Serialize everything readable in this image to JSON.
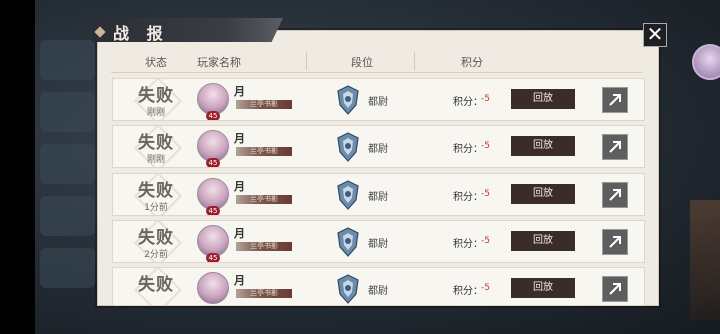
{
  "window": {
    "title": "战 报",
    "close_label": "✕"
  },
  "header": {
    "status": "状态",
    "player": "玩家名称",
    "rank": "段位",
    "score": "积分"
  },
  "rows": [
    {
      "status": "失败",
      "time": "刚刚",
      "name": "月",
      "title": "兰亭书影",
      "level": "45",
      "rank": "都尉",
      "score_label": "积分：",
      "score": "-5",
      "replay": "回放"
    },
    {
      "status": "失败",
      "time": "刚刚",
      "name": "月",
      "title": "兰亭书影",
      "level": "45",
      "rank": "都尉",
      "score_label": "积分：",
      "score": "-5",
      "replay": "回放"
    },
    {
      "status": "失败",
      "time": "1分前",
      "name": "月",
      "title": "兰亭书影",
      "level": "45",
      "rank": "都尉",
      "score_label": "积分：",
      "score": "-5",
      "replay": "回放"
    },
    {
      "status": "失败",
      "time": "2分前",
      "name": "月",
      "title": "兰亭书影",
      "level": "45",
      "rank": "都尉",
      "score_label": "积分：",
      "score": "-5",
      "replay": "回放"
    },
    {
      "status": "失败",
      "time": "",
      "name": "月",
      "title": "兰亭书影",
      "level": "",
      "rank": "都尉",
      "score_label": "积分：",
      "score": "-5",
      "replay": "回放"
    }
  ],
  "colors": {
    "replay_bg": "#3a2c28",
    "score_red": "#c23a33",
    "level_badge": "#9b1f2a",
    "title_bar": "#2a2d33"
  }
}
